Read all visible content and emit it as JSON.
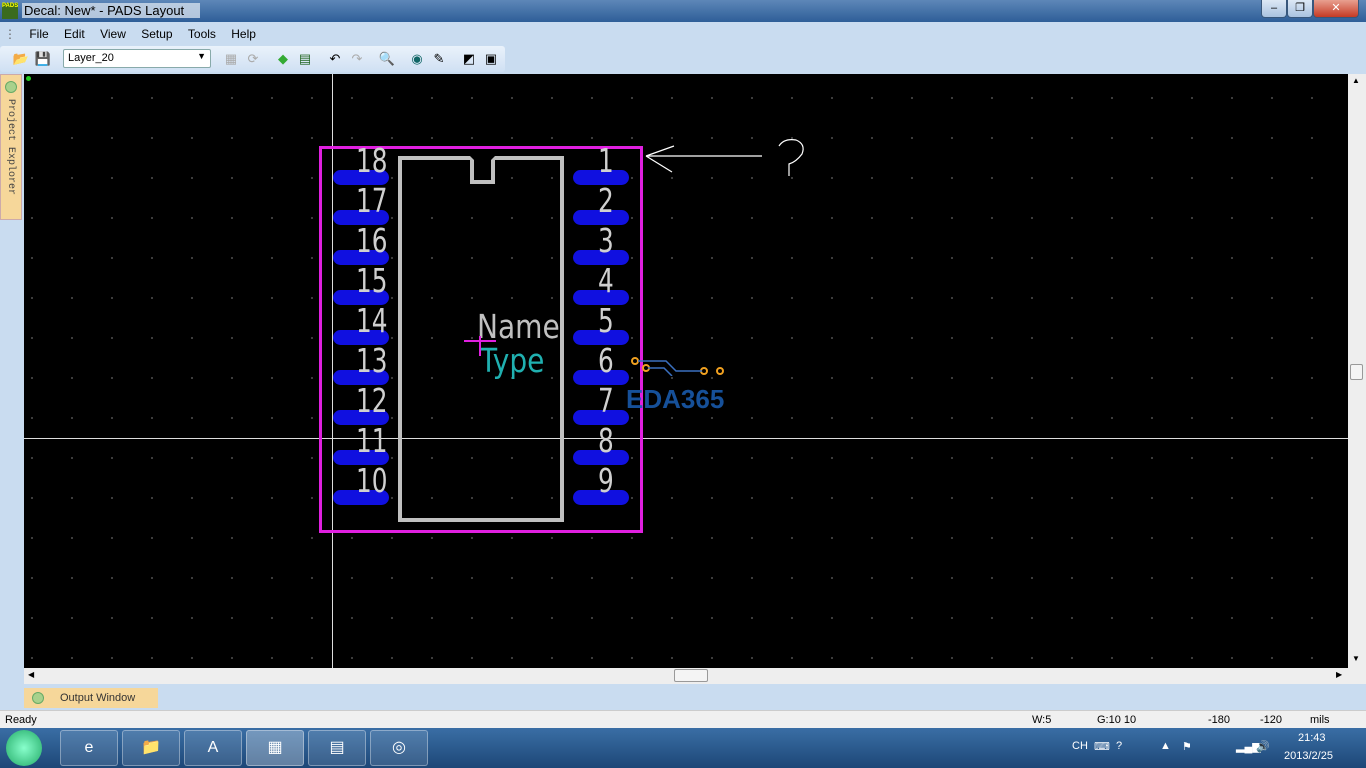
{
  "window": {
    "title": "Decal: New* - PADS Layout",
    "app_icon": "PADS"
  },
  "menu": [
    "File",
    "Edit",
    "View",
    "Setup",
    "Tools",
    "Help"
  ],
  "toolbar": {
    "layer": "Layer_20",
    "icons": [
      "open-icon",
      "save-icon",
      "properties-icon",
      "refresh-icon",
      "add-icon",
      "decal-icon",
      "undo-icon",
      "redo-icon",
      "zoom-icon",
      "display-icon",
      "paint-icon",
      "export-icon",
      "window-icon"
    ]
  },
  "side_panel": {
    "label": "Project Explorer"
  },
  "decal": {
    "left_pins": [
      "18",
      "17",
      "16",
      "15",
      "14",
      "13",
      "12",
      "11",
      "10"
    ],
    "right_pins": [
      "1",
      "2",
      "3",
      "4",
      "5",
      "6",
      "7",
      "8",
      "9"
    ],
    "name_label": "Name",
    "type_label": "Type",
    "annotation": "?",
    "watermark": "EDA365"
  },
  "output_tab": "Output Window",
  "status": {
    "ready": "Ready",
    "width": "W:5",
    "grid": "G:10 10",
    "x": "-180",
    "y": "-120",
    "units": "mils"
  },
  "taskbar": {
    "lang": "CH",
    "time": "21:43",
    "date": "2013/2/25"
  },
  "colors": {
    "pad": "#1010e0",
    "outline": "#e020e0",
    "body": "#c0c0c0",
    "type": "#20b0b0"
  }
}
